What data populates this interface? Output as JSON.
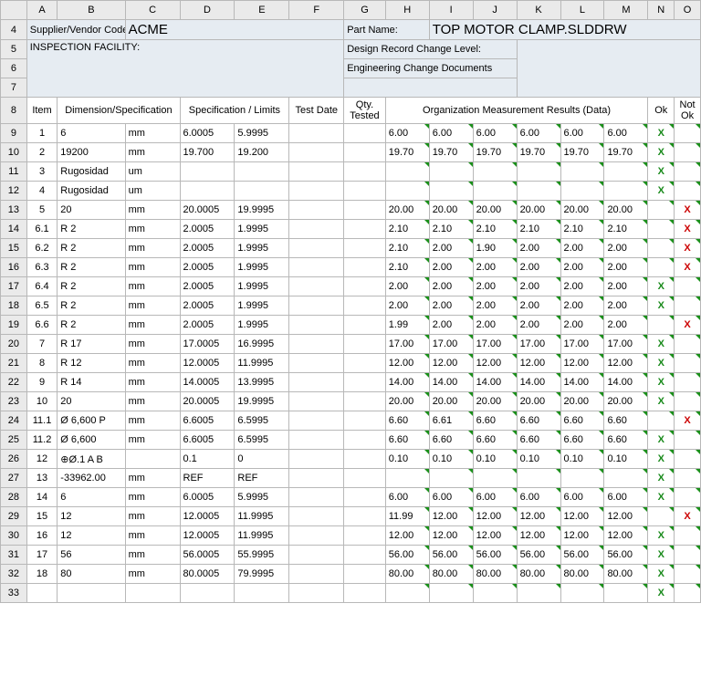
{
  "colHeaders": [
    "A",
    "B",
    "C",
    "D",
    "E",
    "F",
    "G",
    "H",
    "I",
    "J",
    "K",
    "L",
    "M",
    "N",
    "O"
  ],
  "header": {
    "supplierLabel": "Supplier/Vendor Code:",
    "supplierValue": "ACME",
    "inspectionLabel": "INSPECTION FACILITY:",
    "partNameLabel": "Part Name:",
    "partNameValue": "TOP MOTOR CLAMP.SLDDRW",
    "designRecordLabel": "Design Record Change Level:",
    "engChangeLabel": "Engineering Change Documents"
  },
  "tableHeaders": {
    "item": "Item",
    "dimSpec": "Dimension/Specification",
    "specLimits": "Specification / Limits",
    "testDate": "Test Date",
    "qtyTested": "Qty. Tested",
    "orgResults": "Organization Measurement Results (Data)",
    "ok": "Ok",
    "notOk": "Not Ok"
  },
  "okMark": "X",
  "nokMark": "X",
  "rows": [
    {
      "rn": 9,
      "item": "1",
      "dim": "6",
      "unit": "mm",
      "hi": "6.0005",
      "lo": "5.9995",
      "res": [
        "6.00",
        "6.00",
        "6.00",
        "6.00",
        "6.00",
        "6.00"
      ],
      "ok": true,
      "nok": false
    },
    {
      "rn": 10,
      "item": "2",
      "dim": "19200",
      "unit": "mm",
      "hi": "19.700",
      "lo": "19.200",
      "res": [
        "19.70",
        "19.70",
        "19.70",
        "19.70",
        "19.70",
        "19.70"
      ],
      "ok": true,
      "nok": false
    },
    {
      "rn": 11,
      "item": "3",
      "dim": "Rugosidad",
      "unit": "um",
      "hi": "",
      "lo": "",
      "res": [
        "",
        "",
        "",
        "",
        "",
        ""
      ],
      "ok": true,
      "nok": false
    },
    {
      "rn": 12,
      "item": "4",
      "dim": "Rugosidad",
      "unit": "um",
      "hi": "",
      "lo": "",
      "res": [
        "",
        "",
        "",
        "",
        "",
        ""
      ],
      "ok": true,
      "nok": false
    },
    {
      "rn": 13,
      "item": "5",
      "dim": "20",
      "unit": "mm",
      "hi": "20.0005",
      "lo": "19.9995",
      "res": [
        "20.00",
        "20.00",
        "20.00",
        "20.00",
        "20.00",
        "20.00"
      ],
      "ok": false,
      "nok": true
    },
    {
      "rn": 14,
      "item": "6.1",
      "dim": "R 2",
      "unit": "mm",
      "hi": "2.0005",
      "lo": "1.9995",
      "res": [
        "2.10",
        "2.10",
        "2.10",
        "2.10",
        "2.10",
        "2.10"
      ],
      "ok": false,
      "nok": true
    },
    {
      "rn": 15,
      "item": "6.2",
      "dim": "R 2",
      "unit": "mm",
      "hi": "2.0005",
      "lo": "1.9995",
      "res": [
        "2.10",
        "2.00",
        "1.90",
        "2.00",
        "2.00",
        "2.00"
      ],
      "ok": false,
      "nok": true
    },
    {
      "rn": 16,
      "item": "6.3",
      "dim": "R 2",
      "unit": "mm",
      "hi": "2.0005",
      "lo": "1.9995",
      "res": [
        "2.10",
        "2.00",
        "2.00",
        "2.00",
        "2.00",
        "2.00"
      ],
      "ok": false,
      "nok": true
    },
    {
      "rn": 17,
      "item": "6.4",
      "dim": "R 2",
      "unit": "mm",
      "hi": "2.0005",
      "lo": "1.9995",
      "res": [
        "2.00",
        "2.00",
        "2.00",
        "2.00",
        "2.00",
        "2.00"
      ],
      "ok": true,
      "nok": false
    },
    {
      "rn": 18,
      "item": "6.5",
      "dim": "R 2",
      "unit": "mm",
      "hi": "2.0005",
      "lo": "1.9995",
      "res": [
        "2.00",
        "2.00",
        "2.00",
        "2.00",
        "2.00",
        "2.00"
      ],
      "ok": true,
      "nok": false
    },
    {
      "rn": 19,
      "item": "6.6",
      "dim": "R 2",
      "unit": "mm",
      "hi": "2.0005",
      "lo": "1.9995",
      "res": [
        "1.99",
        "2.00",
        "2.00",
        "2.00",
        "2.00",
        "2.00"
      ],
      "ok": false,
      "nok": true
    },
    {
      "rn": 20,
      "item": "7",
      "dim": "R 17",
      "unit": "mm",
      "hi": "17.0005",
      "lo": "16.9995",
      "res": [
        "17.00",
        "17.00",
        "17.00",
        "17.00",
        "17.00",
        "17.00"
      ],
      "ok": true,
      "nok": false
    },
    {
      "rn": 21,
      "item": "8",
      "dim": "R 12",
      "unit": "mm",
      "hi": "12.0005",
      "lo": "11.9995",
      "res": [
        "12.00",
        "12.00",
        "12.00",
        "12.00",
        "12.00",
        "12.00"
      ],
      "ok": true,
      "nok": false
    },
    {
      "rn": 22,
      "item": "9",
      "dim": "R 14",
      "unit": "mm",
      "hi": "14.0005",
      "lo": "13.9995",
      "res": [
        "14.00",
        "14.00",
        "14.00",
        "14.00",
        "14.00",
        "14.00"
      ],
      "ok": true,
      "nok": false
    },
    {
      "rn": 23,
      "item": "10",
      "dim": "20",
      "unit": "mm",
      "hi": "20.0005",
      "lo": "19.9995",
      "res": [
        "20.00",
        "20.00",
        "20.00",
        "20.00",
        "20.00",
        "20.00"
      ],
      "ok": true,
      "nok": false
    },
    {
      "rn": 24,
      "item": "11.1",
      "dim": "Ø 6,600 P",
      "unit": "mm",
      "hi": "6.6005",
      "lo": "6.5995",
      "res": [
        "6.60",
        "6.61",
        "6.60",
        "6.60",
        "6.60",
        "6.60"
      ],
      "ok": false,
      "nok": true
    },
    {
      "rn": 25,
      "item": "11.2",
      "dim": "Ø 6,600",
      "unit": "mm",
      "hi": "6.6005",
      "lo": "6.5995",
      "res": [
        "6.60",
        "6.60",
        "6.60",
        "6.60",
        "6.60",
        "6.60"
      ],
      "ok": true,
      "nok": false
    },
    {
      "rn": 26,
      "item": "12",
      "dim": "⊕Ø.1 A B",
      "unit": "",
      "hi": "0.1",
      "lo": "0",
      "res": [
        "0.10",
        "0.10",
        "0.10",
        "0.10",
        "0.10",
        "0.10"
      ],
      "ok": true,
      "nok": false
    },
    {
      "rn": 27,
      "item": "13",
      "dim": "-33962.00",
      "unit": "mm",
      "hi": "REF",
      "lo": "REF",
      "res": [
        "",
        "",
        "",
        "",
        "",
        ""
      ],
      "ok": true,
      "nok": false
    },
    {
      "rn": 28,
      "item": "14",
      "dim": "6",
      "unit": "mm",
      "hi": "6.0005",
      "lo": "5.9995",
      "res": [
        "6.00",
        "6.00",
        "6.00",
        "6.00",
        "6.00",
        "6.00"
      ],
      "ok": true,
      "nok": false
    },
    {
      "rn": 29,
      "item": "15",
      "dim": "12",
      "unit": "mm",
      "hi": "12.0005",
      "lo": "11.9995",
      "res": [
        "11.99",
        "12.00",
        "12.00",
        "12.00",
        "12.00",
        "12.00"
      ],
      "ok": false,
      "nok": true
    },
    {
      "rn": 30,
      "item": "16",
      "dim": "12",
      "unit": "mm",
      "hi": "12.0005",
      "lo": "11.9995",
      "res": [
        "12.00",
        "12.00",
        "12.00",
        "12.00",
        "12.00",
        "12.00"
      ],
      "ok": true,
      "nok": false
    },
    {
      "rn": 31,
      "item": "17",
      "dim": "56",
      "unit": "mm",
      "hi": "56.0005",
      "lo": "55.9995",
      "res": [
        "56.00",
        "56.00",
        "56.00",
        "56.00",
        "56.00",
        "56.00"
      ],
      "ok": true,
      "nok": false
    },
    {
      "rn": 32,
      "item": "18",
      "dim": "80",
      "unit": "mm",
      "hi": "80.0005",
      "lo": "79.9995",
      "res": [
        "80.00",
        "80.00",
        "80.00",
        "80.00",
        "80.00",
        "80.00"
      ],
      "ok": true,
      "nok": false
    },
    {
      "rn": 33,
      "item": "",
      "dim": "",
      "unit": "",
      "hi": "",
      "lo": "",
      "res": [
        "",
        "",
        "",
        "",
        "",
        ""
      ],
      "ok": true,
      "nok": false
    }
  ]
}
